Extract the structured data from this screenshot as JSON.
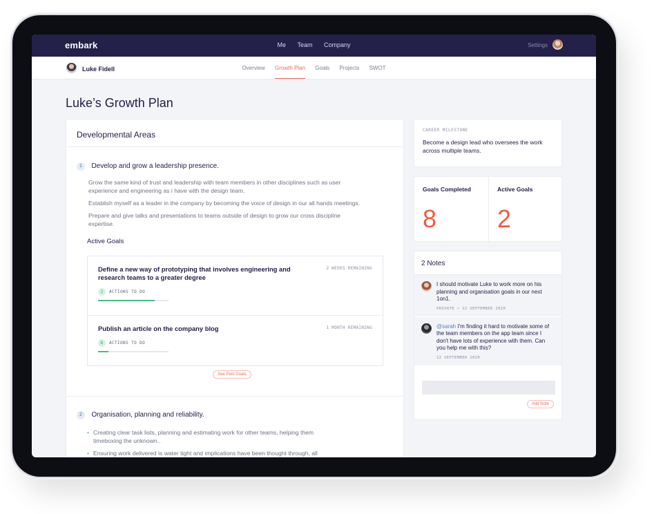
{
  "app": {
    "logo": "embark"
  },
  "topnav": {
    "items": [
      "Me",
      "Team",
      "Company"
    ],
    "settings": "Settings"
  },
  "subnav": {
    "user_name": "Luke Fidell",
    "tabs": [
      "Overview",
      "Growth Plan",
      "Goals",
      "Projects",
      "SWOT"
    ],
    "active_tab": "Growth Plan"
  },
  "page": {
    "title": "Luke’s Growth Plan"
  },
  "developmental": {
    "heading": "Developmental Areas",
    "areas": [
      {
        "number": "1",
        "title": "Develop and grow a leadership presence.",
        "paragraphs": [
          "Grow the same kind of trust and leadership with team members in other disciplines such as user experience and engineering as i have with the design team.",
          "Establish myself as a leader in the company by becoming the voice of design in our all hands meetings.",
          "Prepare and give talks and presentations to teams outside of design to grow our cross discipline expertise."
        ]
      },
      {
        "number": "2",
        "title": "Organisation, planning and reliability.",
        "bullets": [
          "Creating clear task lists, planning and estimating work for other teams, helping them timeboxing the unknown..",
          "Ensuring work delivered is water tight and implications have been thought through, all"
        ]
      }
    ],
    "active_goals_heading": "Active Goals",
    "goals": [
      {
        "title": "Define a new way of prototyping that involves engineering and research teams to a greater degree",
        "remaining": "2 WEEKS REMAINING",
        "actions_count": "2",
        "actions_label": "ACTIONS TO DO",
        "progress": 0.8
      },
      {
        "title": "Publish an article on the company blog",
        "remaining": "1 MONTH REMAINING",
        "actions_count": "6",
        "actions_label": "ACTIONS TO DO",
        "progress": 0.15
      }
    ],
    "see_past_goals": "See Past Goals"
  },
  "milestone": {
    "label": "CAREER MILESTONE",
    "text": "Become a design lead who oversees the work across multiple teams."
  },
  "stats": {
    "completed_label": "Goals Completed",
    "completed_value": "8",
    "active_label": "Active Goals",
    "active_value": "2"
  },
  "notes": {
    "heading": "2 Notes",
    "items": [
      {
        "text": "I should motivate Luke to work more on his planning and organisation goals in our next 1on1.",
        "meta": "PRIVATE • 12 SEPTEMBER 2020"
      },
      {
        "mention": "@sarah",
        "text": " I'm finding it hard to motivate some of the team members on the app team since I don't have lots of experience with them. Can you help me with this?",
        "meta": "12 SEPTEMBER 2020"
      }
    ],
    "add_note": "Add Note"
  },
  "colors": {
    "nav_bg": "#23204a",
    "accent": "#ee6b55",
    "stat_number": "#f15d3e",
    "progress": "#44c07e"
  }
}
